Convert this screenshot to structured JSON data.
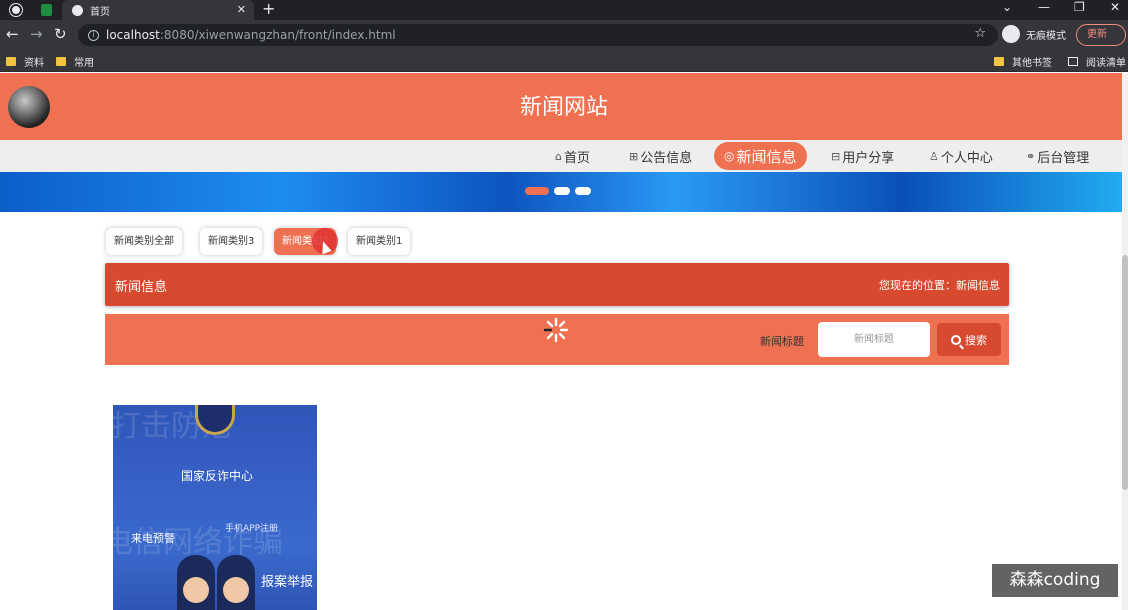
{
  "browser": {
    "tab_title": "首页",
    "url_host": "localhost",
    "url_rest": ":8080/xiwenwangzhan/front/index.html",
    "incognito_label": "无痕模式",
    "update_label": "更新",
    "new_tab_glyph": "+",
    "tab_close_glyph": "✕",
    "back_glyph": "←",
    "forward_glyph": "→",
    "reload_glyph": "↻",
    "star_glyph": "☆",
    "menu_glyph": "⋮",
    "window_controls": [
      "⌄",
      "—",
      "❐",
      "✕"
    ],
    "bookmarks": [
      "资料",
      "常用"
    ],
    "bookmarks_right": [
      "其他书签",
      "阅读清单"
    ]
  },
  "site": {
    "title": "新闻网站",
    "accent_color": "#ef7152",
    "dark_accent_color": "#d84a30"
  },
  "nav": {
    "items": [
      {
        "label": "首页",
        "icon": "home-icon",
        "glyph": "⌂"
      },
      {
        "label": "公告信息",
        "icon": "grid-icon",
        "glyph": "⊞"
      },
      {
        "label": "新闻信息",
        "icon": "circle-icon",
        "glyph": "◎"
      },
      {
        "label": "用户分享",
        "icon": "panel-icon",
        "glyph": "⊟"
      },
      {
        "label": "个人中心",
        "icon": "user-icon",
        "glyph": "♙"
      },
      {
        "label": "后台管理",
        "icon": "link-icon",
        "glyph": "⚭"
      }
    ],
    "active": "新闻信息"
  },
  "categories": {
    "items": [
      "新闻类别全部",
      "新闻类别3",
      "新闻类别2",
      "新闻类别1"
    ],
    "active": "新闻类别2"
  },
  "section": {
    "title": "新闻信息",
    "location_label": "您现在的位置：新闻信息"
  },
  "search": {
    "label": "新闻标题",
    "placeholder": "新闻标题",
    "button_label": "搜索"
  },
  "news_image": {
    "center_name": "国家反诈中心",
    "text_left": "来电预警",
    "text_app": "手机APP注册",
    "text_report": "报案举报",
    "bg_line_1": "打击防范",
    "bg_line_2": "电信网络诈骗"
  },
  "watermark": "森森coding"
}
